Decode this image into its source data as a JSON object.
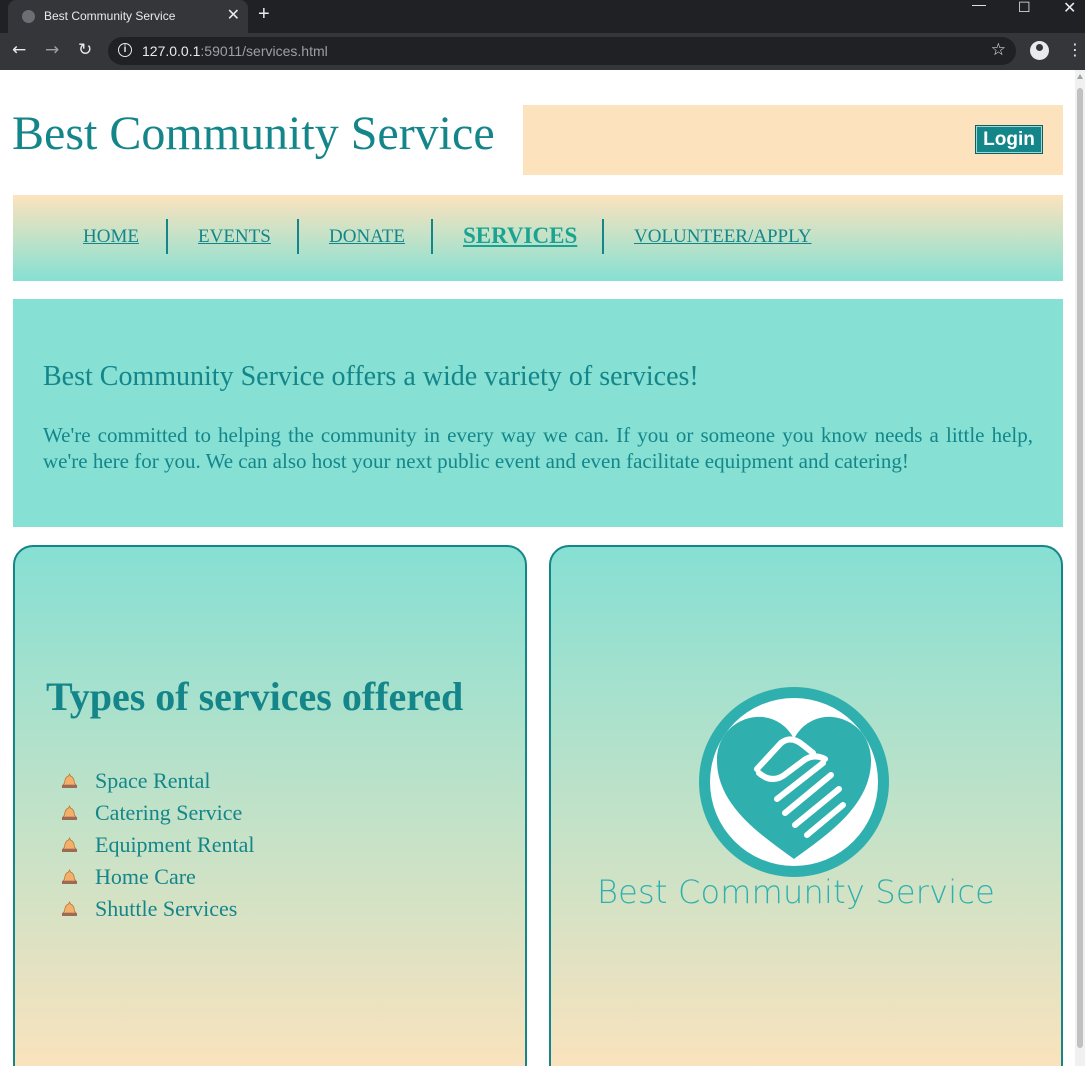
{
  "browser": {
    "tab_title": "Best Community Service",
    "url_host": "127.0.0.1",
    "url_rest": ":59011/services.html"
  },
  "header": {
    "site_title": "Best Community Service",
    "login_label": "Login"
  },
  "nav": {
    "items": [
      {
        "label": "HOME",
        "active": false
      },
      {
        "label": "EVENTS",
        "active": false
      },
      {
        "label": "DONATE",
        "active": false
      },
      {
        "label": "SERVICES",
        "active": true
      },
      {
        "label": "VOLUNTEER/APPLY",
        "active": false
      }
    ]
  },
  "intro": {
    "heading": "Best Community Service offers a wide variety of services!",
    "body": "We're committed to helping the community in every way we can. If you or someone you know needs a little help, we're here for you. We can also host your next public event and even facilitate equipment and catering!"
  },
  "services": {
    "heading": "Types of services offered",
    "items": [
      "Space Rental",
      "Catering Service",
      "Equipment Rental",
      "Home Care",
      "Shuttle Services"
    ],
    "bullet_icon": "bell-icon"
  },
  "logo": {
    "text": "Best Community Service",
    "icon": "handshake-heart-icon"
  },
  "colors": {
    "teal": "#14868a",
    "mint": "#86e0d3",
    "peach": "#fde3bd",
    "logo_teal": "#2fb0ae"
  }
}
